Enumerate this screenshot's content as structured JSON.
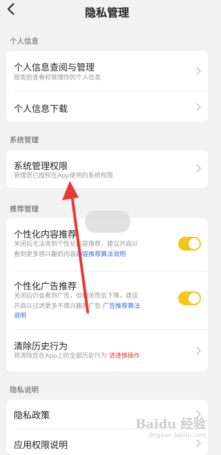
{
  "header": {
    "title": "隐私管理"
  },
  "sections": {
    "personal": {
      "label": "个人信息",
      "items": [
        {
          "title": "个人信息查阅与管理",
          "desc": "按类别查看和管理你的个人信息"
        },
        {
          "title": "个人信息下载"
        }
      ]
    },
    "system": {
      "label": "系统管理",
      "items": [
        {
          "title": "系统管理权限",
          "desc": "管理您已授权在App使用的系统权限"
        }
      ]
    },
    "recommend": {
      "label": "推荐管理",
      "items": [
        {
          "title": "个性化内容推荐",
          "desc_line1": "关闭后无法收到个性化内容推荐，建议开启以",
          "desc_line2": "看到更多感兴趣的内容",
          "desc_link": "内容推荐算法说明",
          "toggle_on": true
        },
        {
          "title": "个性化广告推荐",
          "desc_line1": "关闭后仍会看到广告，但相关性会下降，建议",
          "desc_line2": "开启以过滤更多不感兴趣的广告",
          "desc_link_a": "广告推荐算法",
          "desc_link_b": "说明",
          "toggle_on": true
        },
        {
          "title": "清除历史行为",
          "desc": "将清除您在App上的全部历史行为",
          "desc_warn": "请谨慎操作"
        }
      ]
    },
    "privacy": {
      "label": "隐私说明",
      "items": [
        {
          "title": "隐私政策"
        },
        {
          "title": "应用权限说明"
        }
      ]
    }
  },
  "watermark": {
    "text": "Baidu 经验",
    "sub": "jingyan.baidu.com"
  },
  "colors": {
    "toggle": "#f5c518",
    "link": "#3a6fd8",
    "warn": "#e04a3a",
    "arrow": "#e53935"
  }
}
